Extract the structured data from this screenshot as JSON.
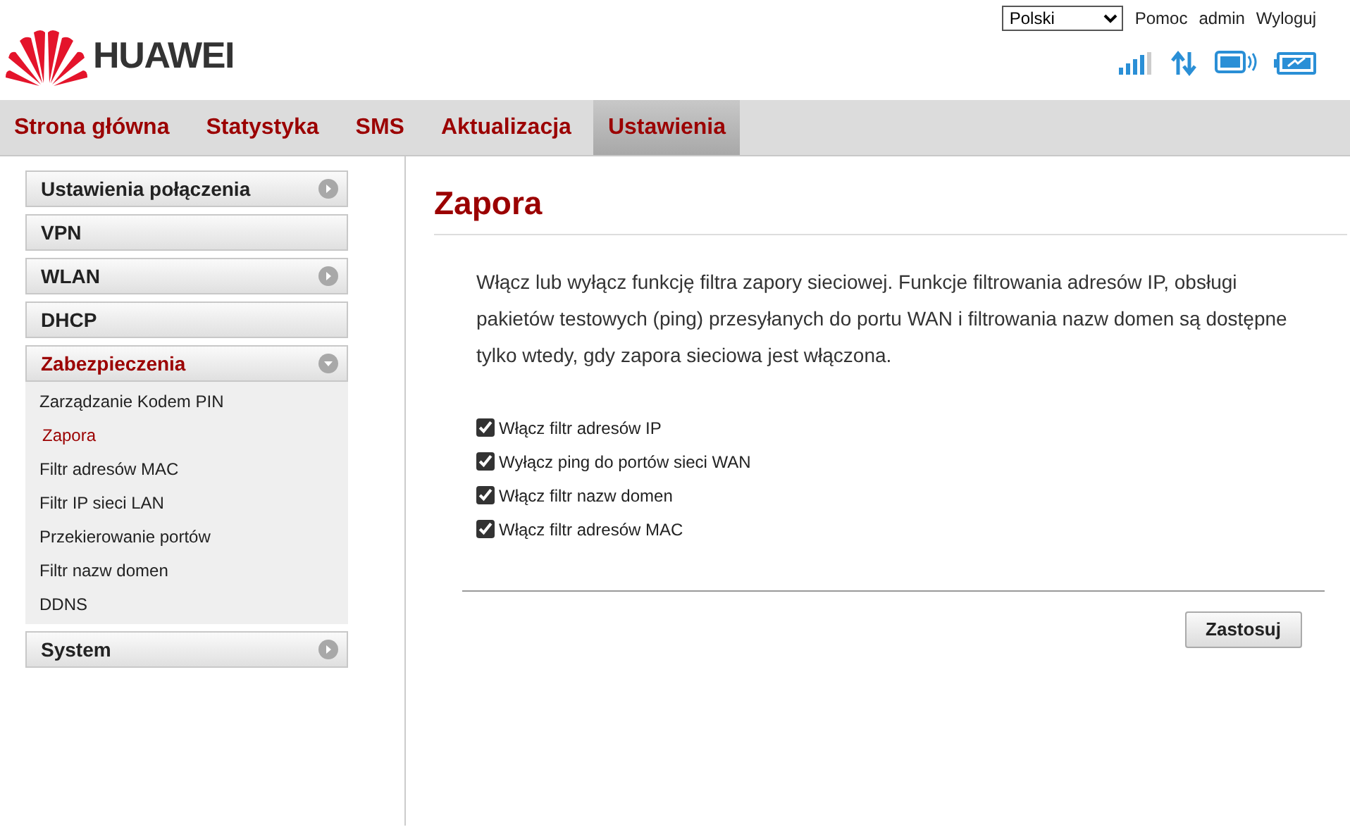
{
  "header": {
    "language": "Polski",
    "links": [
      "Pomoc",
      "admin",
      "Wyloguj"
    ],
    "logo": "HUAWEI"
  },
  "nav": [
    {
      "label": "Strona główna",
      "selected": false
    },
    {
      "label": "Statystyka",
      "selected": false
    },
    {
      "label": "SMS",
      "selected": false
    },
    {
      "label": "Aktualizacja",
      "selected": false
    },
    {
      "label": "Ustawienia",
      "selected": true
    }
  ],
  "sidebar": {
    "items": [
      {
        "label": "Ustawienia połączenia",
        "expandable": true,
        "expanded": false,
        "selected": false
      },
      {
        "label": "VPN",
        "expandable": false,
        "selected": false
      },
      {
        "label": "WLAN",
        "expandable": true,
        "expanded": false,
        "selected": false
      },
      {
        "label": "DHCP",
        "expandable": false,
        "selected": false
      },
      {
        "label": "Zabezpieczenia",
        "expandable": true,
        "expanded": true,
        "selected": true,
        "children": [
          {
            "label": "Zarządzanie Kodem PIN",
            "selected": false
          },
          {
            "label": "Zapora",
            "selected": true
          },
          {
            "label": "Filtr adresów MAC",
            "selected": false
          },
          {
            "label": "Filtr IP sieci LAN",
            "selected": false
          },
          {
            "label": "Przekierowanie portów",
            "selected": false
          },
          {
            "label": "Filtr nazw domen",
            "selected": false
          },
          {
            "label": "DDNS",
            "selected": false
          }
        ]
      },
      {
        "label": "System",
        "expandable": true,
        "expanded": false,
        "selected": false
      }
    ]
  },
  "content": {
    "title": "Zapora",
    "description": "Włącz lub wyłącz funkcję filtra zapory sieciowej. Funkcje filtrowania adresów IP, obsługi pakietów testowych (ping) przesyłanych do portu WAN i filtrowania nazw domen są dostępne tylko wtedy, gdy zapora sieciowa jest włączona.",
    "options": [
      {
        "label": "Włącz filtr adresów IP",
        "checked": true
      },
      {
        "label": "Wyłącz ping do portów sieci WAN",
        "checked": true
      },
      {
        "label": "Włącz filtr nazw domen",
        "checked": true
      },
      {
        "label": "Włącz filtr adresów MAC",
        "checked": true
      }
    ],
    "apply_button": "Zastosuj"
  }
}
